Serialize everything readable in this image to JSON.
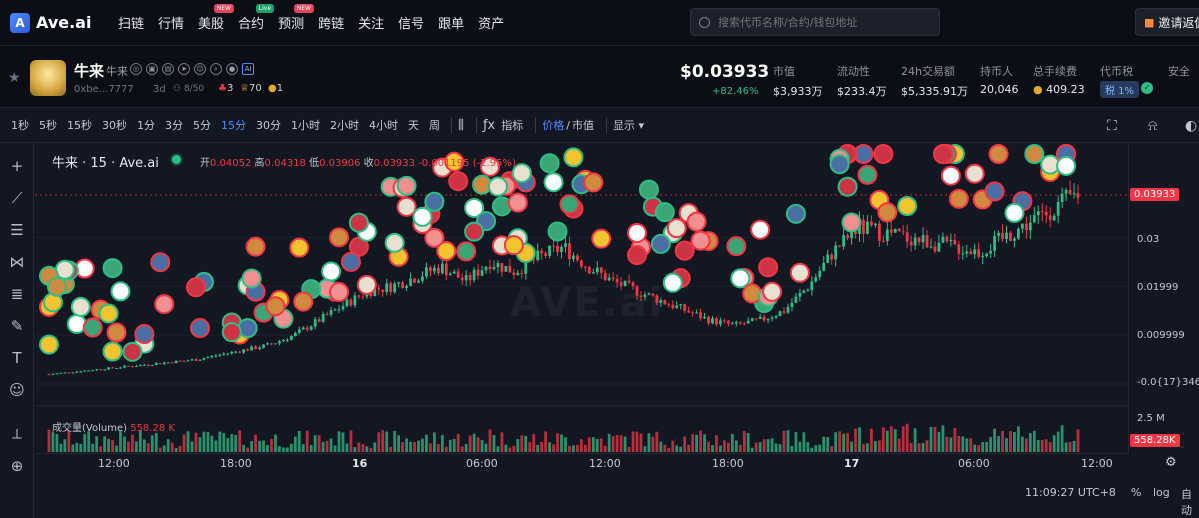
{
  "app": {
    "name": "Ave.ai"
  },
  "nav": {
    "items": [
      {
        "label": "扫链"
      },
      {
        "label": "行情"
      },
      {
        "label": "美股",
        "badge": "NEW"
      },
      {
        "label": "合约",
        "badge": "Live"
      },
      {
        "label": "预测",
        "badge": "NEW"
      },
      {
        "label": "跨链"
      },
      {
        "label": "关注"
      },
      {
        "label": "信号"
      },
      {
        "label": "跟单"
      },
      {
        "label": "资产"
      }
    ],
    "search_placeholder": "搜索代币名称/合约/钱包地址",
    "invite_label": "邀请返佣"
  },
  "token": {
    "name": "牛来",
    "symbol": "牛来",
    "address": "0xbe...7777",
    "age": "3d",
    "score": "8/50",
    "stat_red": "3",
    "stat_trophy": "70",
    "stat_coin": "1",
    "price": "$0.03933",
    "change": "+82.46%",
    "stats": [
      {
        "label": "市值",
        "value": "$3,933万"
      },
      {
        "label": "流动性",
        "value": "$233.4万"
      },
      {
        "label": "24h交易额",
        "value": "$5,335.91万"
      },
      {
        "label": "持币人",
        "value": "20,046"
      },
      {
        "label": "总手续费",
        "value": "409.23"
      },
      {
        "label": "代币税",
        "value": "税 1%"
      },
      {
        "label": "安全",
        "value": ""
      }
    ]
  },
  "toolbar": {
    "intervals": [
      "1秒",
      "5秒",
      "15秒",
      "30秒",
      "1分",
      "3分",
      "5分",
      "15分",
      "30分",
      "1小时",
      "2小时",
      "4小时",
      "天",
      "周"
    ],
    "active_interval": "15分",
    "indicator_label": "指标",
    "price_label": "价格",
    "slash": "/",
    "mcap_label": "市值",
    "display_label": "显示"
  },
  "legend": {
    "title": "牛来 · 15 · Ave.ai",
    "open_label": "开",
    "open": "0.04052",
    "high_label": "高",
    "high": "0.04318",
    "low_label": "低",
    "low": "0.03906",
    "close_label": "收",
    "close": "0.03933",
    "change": "-0.001195 (-2.95%)",
    "volume_label": "成交量(Volume)",
    "volume": "558.28 K"
  },
  "watermark": "AVE.ai",
  "chart_data": {
    "type": "candlestick",
    "price_axis_labels": [
      "0.03",
      "0.01999",
      "0.009999",
      "-0.0{17}346"
    ],
    "last_price": "0.03933",
    "volume_axis_label": "2.5 M",
    "last_volume": "558.28K",
    "time_labels": [
      "12:00",
      "18:00",
      "16",
      "06:00",
      "12:00",
      "18:00",
      "17",
      "06:00",
      "12:00"
    ],
    "day_labels": [
      "16",
      "17"
    ],
    "series_close_approx": [
      0.002,
      0.0025,
      0.003,
      0.0035,
      0.004,
      0.0045,
      0.005,
      0.006,
      0.007,
      0.008,
      0.01,
      0.013,
      0.016,
      0.019,
      0.02,
      0.022,
      0.024,
      0.021,
      0.025,
      0.023,
      0.026,
      0.028,
      0.024,
      0.021,
      0.019,
      0.017,
      0.015,
      0.013,
      0.012,
      0.013,
      0.015,
      0.02,
      0.027,
      0.032,
      0.031,
      0.03,
      0.029,
      0.028,
      0.027,
      0.03,
      0.033,
      0.036,
      0.039
    ]
  },
  "footer": {
    "time": "11:09:27 UTC+8",
    "percent_label": "%",
    "log_label": "log",
    "auto_label": "自动"
  },
  "colors": {
    "up": "#2ebd85",
    "down": "#f23645",
    "accent": "#4f8cff"
  }
}
